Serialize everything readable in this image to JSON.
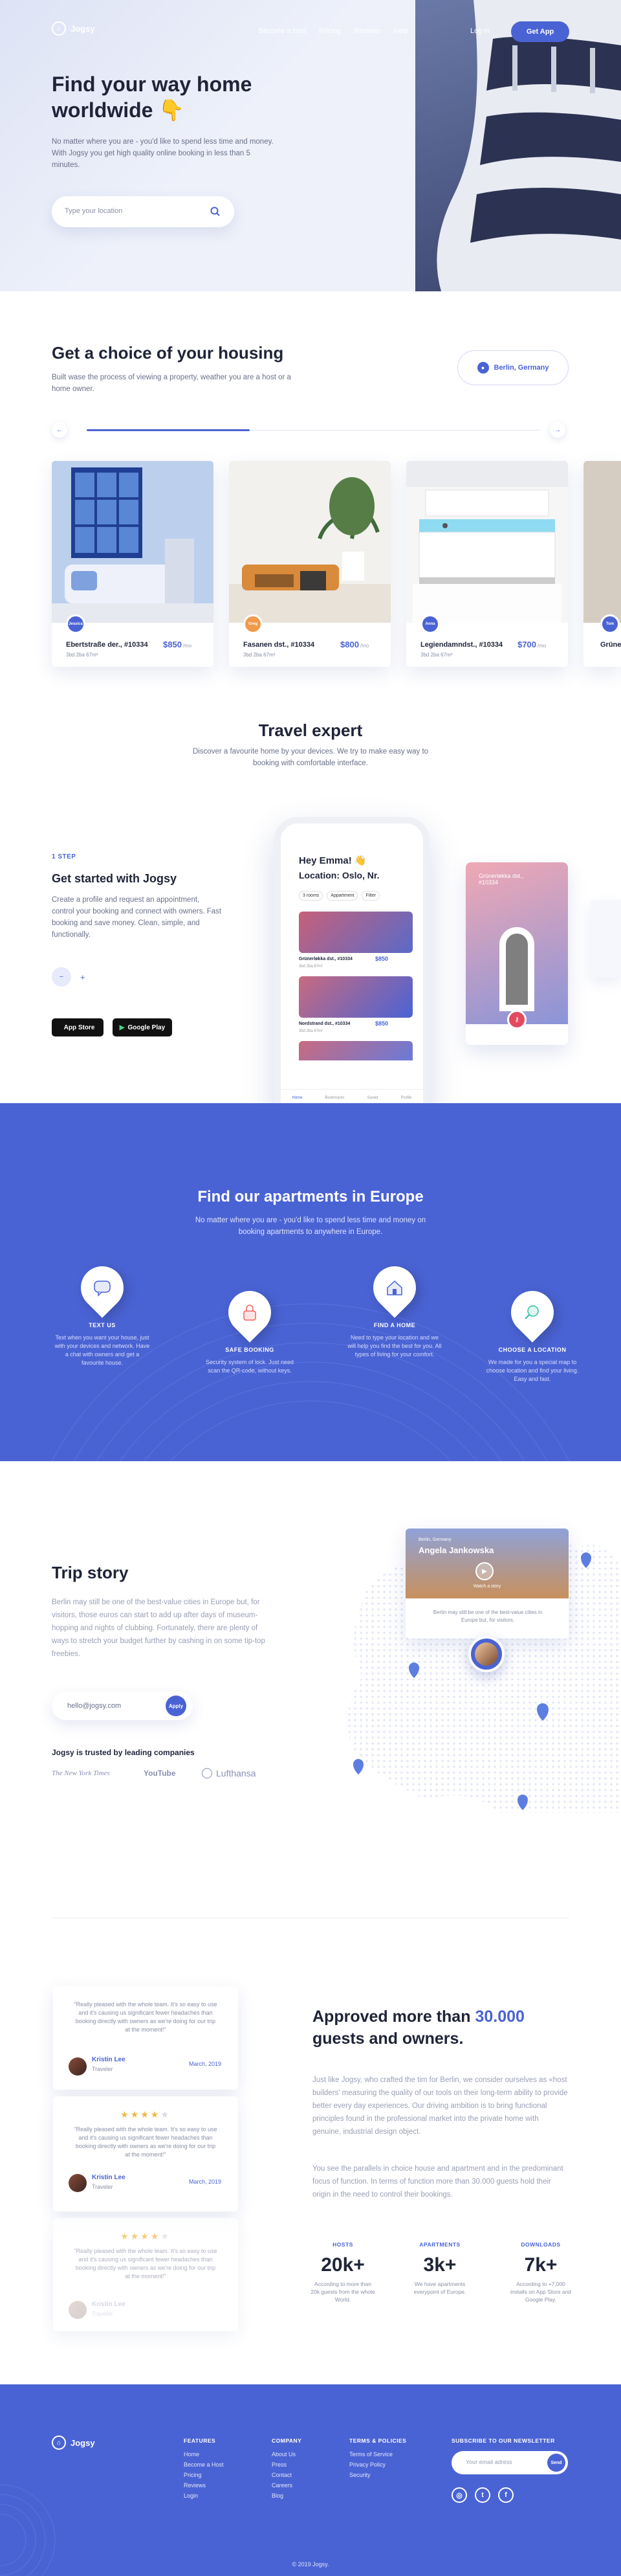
{
  "nav": {
    "logo": "Jogsy",
    "links": [
      "Become a host",
      "Pricing",
      "Reviews",
      "Help"
    ],
    "login": "Log in",
    "cta": "Get App"
  },
  "hero": {
    "title": "Find your way home worldwide 👇",
    "text": "No matter where you are - you'd like to spend less time and money. With Jogsy you get high quality online booking in less than 5 minutes.",
    "search_placeholder": "Type your location"
  },
  "housing": {
    "title": "Get a choice of your housing",
    "subtitle": "Built wase the process of viewing a property, weather you are a host or a home owner.",
    "location": "Berlin, Germany",
    "cards": [
      {
        "name": "Ebertstraße der., #10334",
        "price": "$850",
        "per": "/mo",
        "meta": "3bd 2ba 67m²",
        "badge": "Jessica",
        "badge_color": "#4a63d4"
      },
      {
        "name": "Fasanen dst., #10334",
        "price": "$800",
        "per": "/mo",
        "meta": "3bd 2ba 67m²",
        "badge": "Greg",
        "badge_color": "#f09a4a"
      },
      {
        "name": "Legiendamndst., #10334",
        "price": "$700",
        "per": "/mo",
        "meta": "3bd 2ba 67m²",
        "badge": "Anna",
        "badge_color": "#4a63d4"
      },
      {
        "name": "Grüne",
        "price": "",
        "per": "",
        "meta": "",
        "badge": "Tom",
        "badge_color": "#4a63d4"
      }
    ]
  },
  "expert": {
    "title": "Travel expert",
    "subtitle": "Discover a favourite home by your devices. We try to make easy way to booking with comfortable interface.",
    "step_label": "1 STEP",
    "heading": "Get started with Jogsy",
    "text": "Create a profile and request an appointment, control your booking and connect with owners. Fast booking and save money. Clean, simple, and functionally.",
    "app_store": "App Store",
    "google_play": "Google Play",
    "phone": {
      "greeting": "Hey Emma! 👋",
      "location_label": "Location:",
      "location": "Oslo, Nr.",
      "chips": [
        "3 rooms",
        "Appartment",
        "Filter"
      ],
      "listings": [
        {
          "name": "Grünerløkka dst., #10334",
          "price": "$850",
          "meta": "3bd 2ba 67m²"
        },
        {
          "name": "Nordstrand dst., #10334",
          "price": "$850",
          "meta": "3bd 2ba 67m²"
        }
      ],
      "tabs": [
        "Home",
        "Bookmarks",
        "Saved",
        "Profile"
      ]
    },
    "side_card": {
      "title": "Grünerløkka dst., #10334"
    }
  },
  "europe": {
    "title": "Find our apartments in Europe",
    "subtitle": "No matter where you are - you'd like to spend less time and money on booking apartments to anywhere in Europe.",
    "steps": [
      {
        "title": "TEXT US",
        "text": "Text when you want your house, just with your devices and network. Have a chat with owners and get a favourite house."
      },
      {
        "title": "SAFE BOOKING",
        "text": "Security system of lock. Just need scan the QR-code, without keys."
      },
      {
        "title": "FIND A HOME",
        "text": "Need to type your location and we will help you find the best for you. All types of living for your comfort."
      },
      {
        "title": "CHOOSE A LOCATION",
        "text": "We made for you a special map to choose location and find your living. Easy and fast."
      }
    ]
  },
  "story": {
    "title": "Trip story",
    "text": "Berlin may still be one of the best-value cities in Europe but, for visitors, those euros can start to add up after days of museum-hopping and nights of clubbing. Fortunately, there are plenty of ways to stretch your budget further by cashing in on some tip-top freebies.",
    "email_placeholder": "hello@jogsy.com",
    "apply": "Apply",
    "trusted": "Jogsy is trusted by leading companies",
    "logos": [
      "The New York Times",
      "YouTube",
      "Lufthansa"
    ],
    "card": {
      "location": "Berlin, Germany",
      "name": "Angela Jankowska",
      "caption": "Watch a story",
      "text": "Berlin may still be one of the best-value cities in Europe but, for visitors."
    }
  },
  "reviews": {
    "items": [
      {
        "text": "\"Really pleased with the whole team. It's so easy to use and it's causing us significant fewer headaches than booking directly with owners as we're doing for our trip at the moment!\"",
        "name": "Kristin Lee",
        "role": "Traveler",
        "date": "March, 2019"
      },
      {
        "text": "\"Really pleased with the whole team. It's so easy to use and it's causing us significant fewer headaches than booking directly with owners as we're doing for our trip at the moment!\"",
        "name": "Kristin Lee",
        "role": "Traveler",
        "date": "March, 2019"
      },
      {
        "text": "\"Really pleased with the whole team. It's so easy to use and it's causing us significant fewer headaches than booking directly with owners as we're doing for our trip at the moment!\"",
        "name": "Kristin Lee",
        "role": "Traveler",
        "date": ""
      }
    ],
    "rating": 4,
    "title_a": "Approved more than",
    "title_num": "30.000",
    "title_b": "guests and owners.",
    "p1": "Just like Jogsy, who crafted the tim for Berlin, we consider ourselves as «host builders' measuring the quality of our tools on their long-term ability to provide better every day experiences. Our driving ambition is to bring functional principles found in the professional market into the private home with genuine, industrial design object.",
    "p2": "You see the parallels in choice house and apartment and in the predominant focus of function. In terms of function more than 30.000 guests hold their origin in the need to control their bookings.",
    "stats": [
      {
        "label": "HOSTS",
        "value": "20k+",
        "desc": "According to more than 20k guests from the whole World."
      },
      {
        "label": "APARTMENTS",
        "value": "3k+",
        "desc": "We have apartments everypoint of Europe."
      },
      {
        "label": "DOWNLOADS",
        "value": "7k+",
        "desc": "According to +7,000 installs on App Store and Google Play."
      }
    ]
  },
  "footer": {
    "logo": "Jogsy",
    "features": {
      "title": "FEATURES",
      "items": [
        "Home",
        "Become a Host",
        "Pricing",
        "Reviews",
        "Login"
      ]
    },
    "company": {
      "title": "COMPANY",
      "items": [
        "About Us",
        "Press",
        "Contact",
        "Careers",
        "Blog"
      ]
    },
    "terms": {
      "title": "TERMS & POLICIES",
      "items": [
        "Terms of Service",
        "Privacy Policy",
        "Security"
      ]
    },
    "newsletter": {
      "title": "SUBSCRIBE TO OUR NEWSLETTER",
      "placeholder": "Your email adress",
      "button": "Send"
    },
    "copyright": "© 2019 Jogsy."
  }
}
